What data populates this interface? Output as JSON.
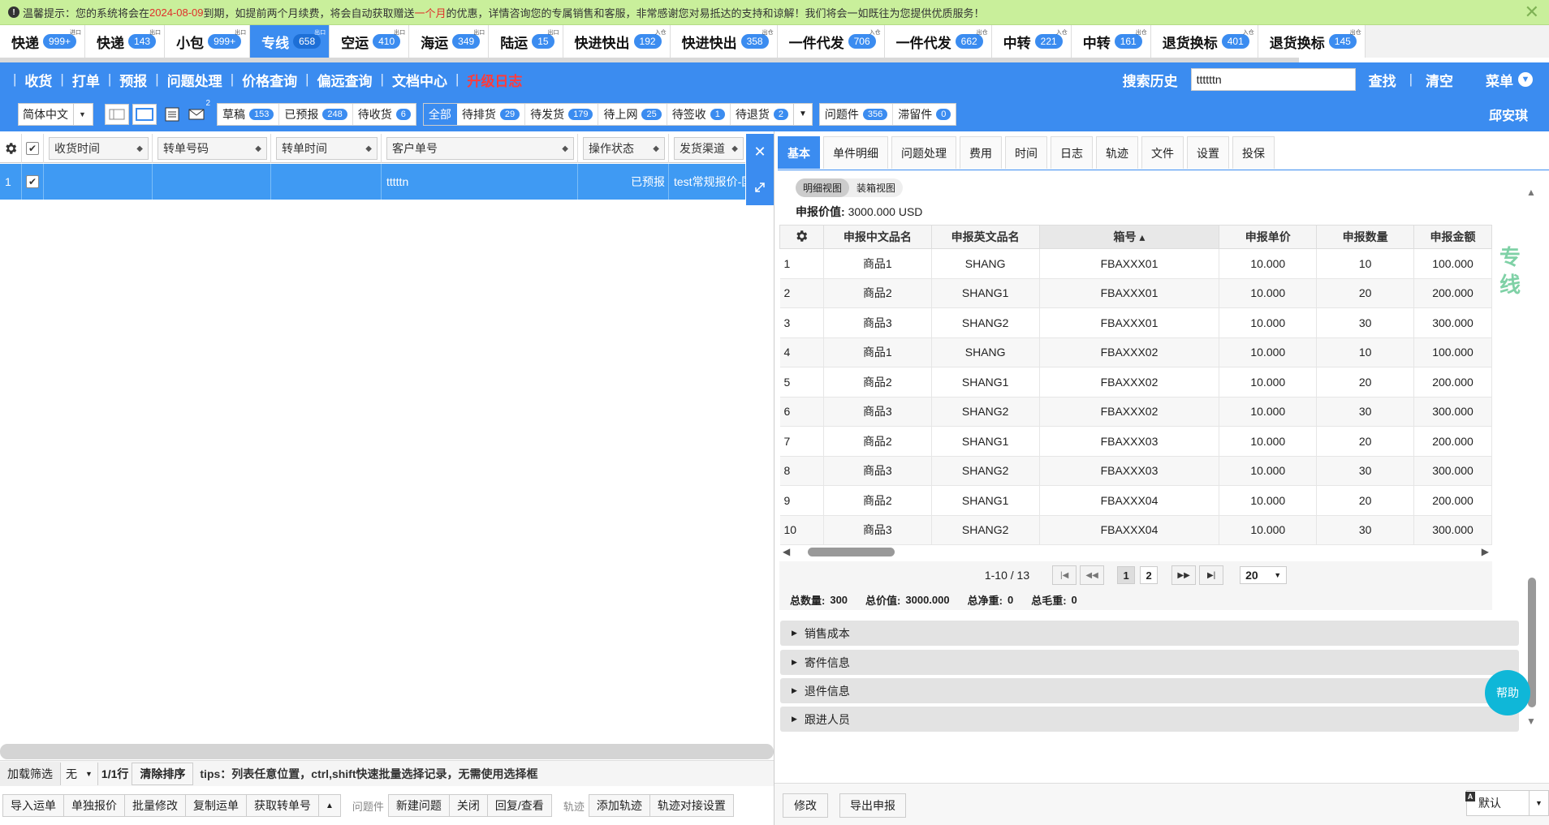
{
  "notice": {
    "pre": "温馨提示：您的系统将会在",
    "date": "2024-08-09",
    "mid": "到期，如提前两个月续费，将会自动获取赠送",
    "gift": "一个月",
    "post": "的优惠，详情咨询您的专属销售和客服，非常感谢您对易抵达的支持和谅解！我们将会一如既往为您提供优质服务！"
  },
  "top_tabs": [
    {
      "label": "快递",
      "badge": "999+",
      "tag": "进口"
    },
    {
      "label": "快递",
      "badge": "143",
      "tag": "出口"
    },
    {
      "label": "小包",
      "badge": "999+",
      "tag": "出口"
    },
    {
      "label": "专线",
      "badge": "658",
      "tag": "出口",
      "active": true
    },
    {
      "label": "空运",
      "badge": "410",
      "tag": "出口"
    },
    {
      "label": "海运",
      "badge": "349",
      "tag": "出口"
    },
    {
      "label": "陆运",
      "badge": "15",
      "tag": "出口"
    },
    {
      "label": "快进快出",
      "badge": "192",
      "tag": "入仓"
    },
    {
      "label": "快进快出",
      "badge": "358",
      "tag": "出仓"
    },
    {
      "label": "一件代发",
      "badge": "706",
      "tag": "入仓"
    },
    {
      "label": "一件代发",
      "badge": "662",
      "tag": "出仓"
    },
    {
      "label": "中转",
      "badge": "221",
      "tag": "入仓"
    },
    {
      "label": "中转",
      "badge": "161",
      "tag": "出仓"
    },
    {
      "label": "退货换标",
      "badge": "401",
      "tag": "入仓"
    },
    {
      "label": "退货换标",
      "badge": "145",
      "tag": "出仓"
    }
  ],
  "nav": {
    "items": [
      "收货",
      "打单",
      "预报",
      "问题处理",
      "价格查询",
      "偏远查询",
      "文档中心"
    ],
    "highlight": "升级日志",
    "search_history": "搜索历史",
    "search_value": "ttttttn",
    "find": "查找",
    "clear": "清空",
    "menu": "菜单"
  },
  "toolbar": {
    "lang": "简体中文",
    "mail_count": "2",
    "status_group1": [
      {
        "label": "草稿",
        "badge": "153"
      },
      {
        "label": "已预报",
        "badge": "248"
      },
      {
        "label": "待收货",
        "badge": "6"
      }
    ],
    "status_group2": [
      {
        "label": "全部",
        "badge": "",
        "active": true
      },
      {
        "label": "待排货",
        "badge": "29"
      },
      {
        "label": "待发货",
        "badge": "179"
      },
      {
        "label": "待上网",
        "badge": "25"
      },
      {
        "label": "待签收",
        "badge": "1"
      },
      {
        "label": "待退货",
        "badge": "2"
      }
    ],
    "status_group3": [
      {
        "label": "问题件",
        "badge": "356"
      },
      {
        "label": "滞留件",
        "badge": "0"
      }
    ],
    "user": "邱安琪"
  },
  "left_grid": {
    "columns": [
      "收货时间",
      "转单号码",
      "转单时间",
      "客户单号",
      "操作状态",
      "发货渠道"
    ],
    "row": {
      "num": "1",
      "c1": "",
      "c2": "",
      "c3": "",
      "customer_no": "tttttn",
      "status": "已预报",
      "channel": "test常规报价-国"
    }
  },
  "left_status": {
    "filter": "加载筛选",
    "filter_value": "无",
    "rows": "1/1行",
    "clear_sort": "清除排序",
    "tips": "tips：列表任意位置，ctrl,shift快速批量选择记录，无需使用选择框"
  },
  "left_buttons": {
    "g1": [
      "导入运单",
      "单独报价",
      "批量修改",
      "复制运单",
      "获取转单号"
    ],
    "problem_label": "问题件",
    "g2": [
      "新建问题",
      "关闭",
      "回复/查看"
    ],
    "track_label": "轨迹",
    "g3": [
      "添加轨迹",
      "轨迹对接设置"
    ]
  },
  "right_tabs": [
    "基本",
    "单件明细",
    "问题处理",
    "费用",
    "时间",
    "日志",
    "轨迹",
    "文件",
    "设置",
    "投保"
  ],
  "view_toggle": [
    "明细视图",
    "装箱视图"
  ],
  "declared_value_label": "申报价值:",
  "declared_value": "3000.000 USD",
  "detail_table": {
    "columns": [
      "申报中文品名",
      "申报英文品名",
      "箱号 ▴",
      "申报单价",
      "申报数量",
      "申报金额"
    ],
    "rows": [
      [
        "1",
        "商品1",
        "SHANG",
        "FBAXXX01",
        "10.000",
        "10",
        "100.000"
      ],
      [
        "2",
        "商品2",
        "SHANG1",
        "FBAXXX01",
        "10.000",
        "20",
        "200.000"
      ],
      [
        "3",
        "商品3",
        "SHANG2",
        "FBAXXX01",
        "10.000",
        "30",
        "300.000"
      ],
      [
        "4",
        "商品1",
        "SHANG",
        "FBAXXX02",
        "10.000",
        "10",
        "100.000"
      ],
      [
        "5",
        "商品2",
        "SHANG1",
        "FBAXXX02",
        "10.000",
        "20",
        "200.000"
      ],
      [
        "6",
        "商品3",
        "SHANG2",
        "FBAXXX02",
        "10.000",
        "30",
        "300.000"
      ],
      [
        "7",
        "商品2",
        "SHANG1",
        "FBAXXX03",
        "10.000",
        "20",
        "200.000"
      ],
      [
        "8",
        "商品3",
        "SHANG2",
        "FBAXXX03",
        "10.000",
        "30",
        "300.000"
      ],
      [
        "9",
        "商品2",
        "SHANG1",
        "FBAXXX04",
        "10.000",
        "20",
        "200.000"
      ],
      [
        "10",
        "商品3",
        "SHANG2",
        "FBAXXX04",
        "10.000",
        "30",
        "300.000"
      ]
    ]
  },
  "pager": {
    "range": "1-10 / 13",
    "pages": [
      "1",
      "2"
    ],
    "size": "20"
  },
  "totals": {
    "qty_label": "总数量:",
    "qty": "300",
    "value_label": "总价值:",
    "value": "3000.000",
    "net_label": "总净重:",
    "net": "0",
    "gross_label": "总毛重:",
    "gross": "0"
  },
  "accordions": [
    "销售成本",
    "寄件信息",
    "退件信息",
    "跟进人员"
  ],
  "vertical_label": "专线",
  "help": "帮助",
  "right_buttons": {
    "edit": "修改",
    "export": "导出申报"
  },
  "lang_select": "默认",
  "colors": {
    "accent": "#3b8cf0",
    "notice_bg": "#c9ef9b",
    "help": "#0fb7d8"
  }
}
